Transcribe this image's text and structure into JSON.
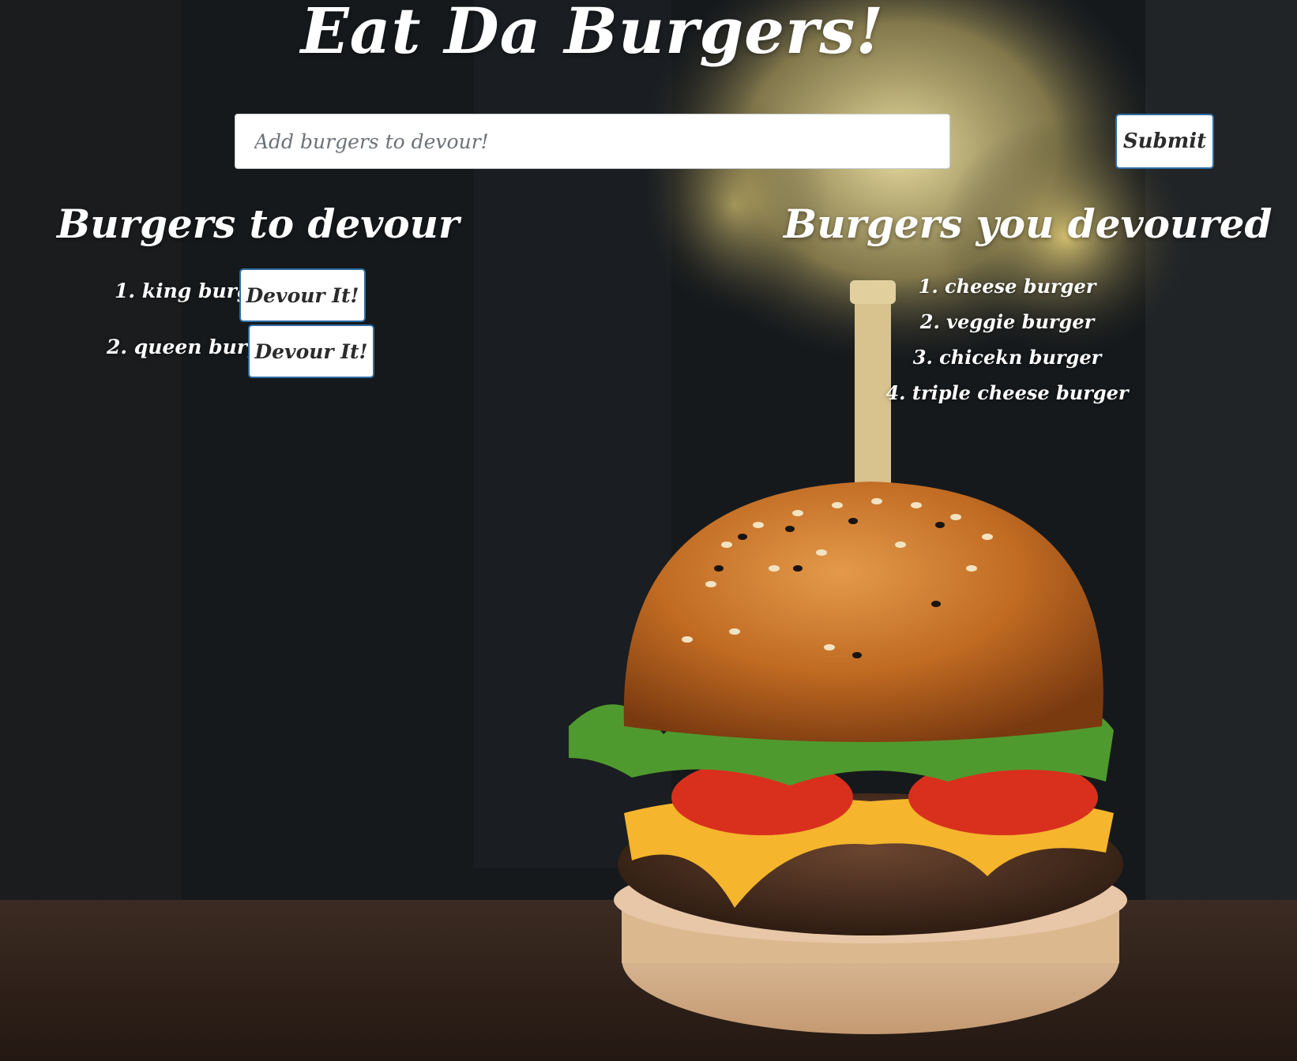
{
  "page": {
    "title": "Eat Da Burgers!"
  },
  "form": {
    "placeholder": "Add burgers to devour!",
    "submit_label": "Submit"
  },
  "to_devour": {
    "heading": "Burgers to devour",
    "items": [
      {
        "label": "1. king burger",
        "button_label": "Devour It!"
      },
      {
        "label": "2. queen burger",
        "button_label": "Devour It!"
      }
    ]
  },
  "devoured": {
    "heading": "Burgers you devoured",
    "items": [
      "1. cheese burger",
      "2. veggie burger",
      "3. chicekn burger",
      "4. triple cheese burger"
    ]
  },
  "colors": {
    "background_dark": "#15181b",
    "button_border": "#2e6da4",
    "text": "#ffffff"
  }
}
